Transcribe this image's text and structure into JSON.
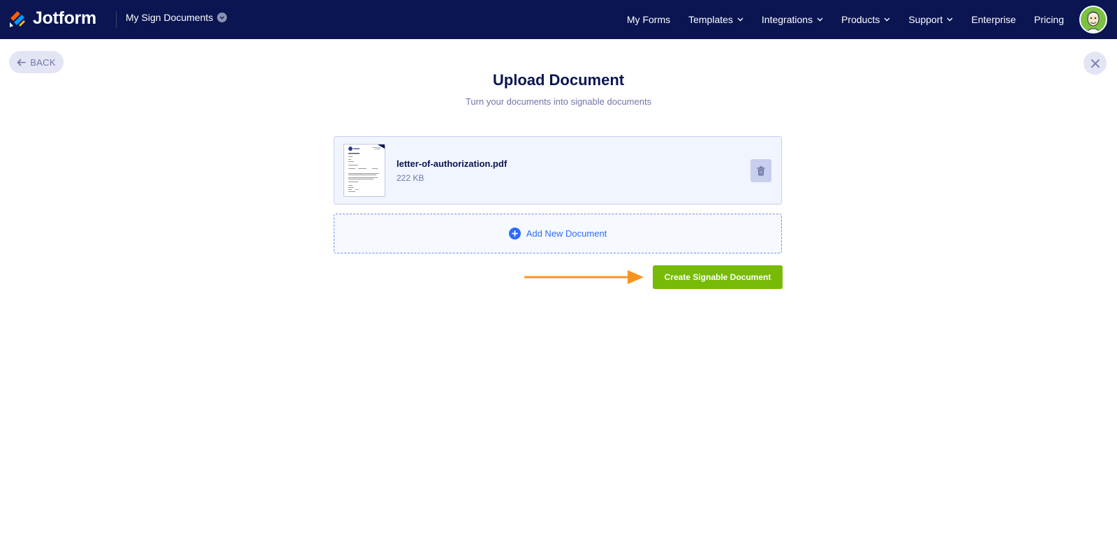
{
  "header": {
    "brand": "Jotform",
    "product_menu": "My Sign Documents",
    "nav": [
      {
        "label": "My Forms",
        "dropdown": false
      },
      {
        "label": "Templates",
        "dropdown": true
      },
      {
        "label": "Integrations",
        "dropdown": true
      },
      {
        "label": "Products",
        "dropdown": true
      },
      {
        "label": "Support",
        "dropdown": true
      },
      {
        "label": "Enterprise",
        "dropdown": false
      },
      {
        "label": "Pricing",
        "dropdown": false
      }
    ],
    "avatar_icon": "user-avatar-icon"
  },
  "back_label": "BACK",
  "close_icon": "close-icon",
  "page": {
    "title": "Upload Document",
    "subtitle": "Turn your documents into signable documents"
  },
  "files": [
    {
      "name": "letter-of-authorization.pdf",
      "size": "222 KB"
    }
  ],
  "add_new_label": "Add New Document",
  "create_label": "Create Signable Document",
  "colors": {
    "navbar": "#0a1551",
    "primary_blue": "#2e69ff",
    "cta_green": "#78bb07",
    "arrow_orange": "#f7941d"
  }
}
